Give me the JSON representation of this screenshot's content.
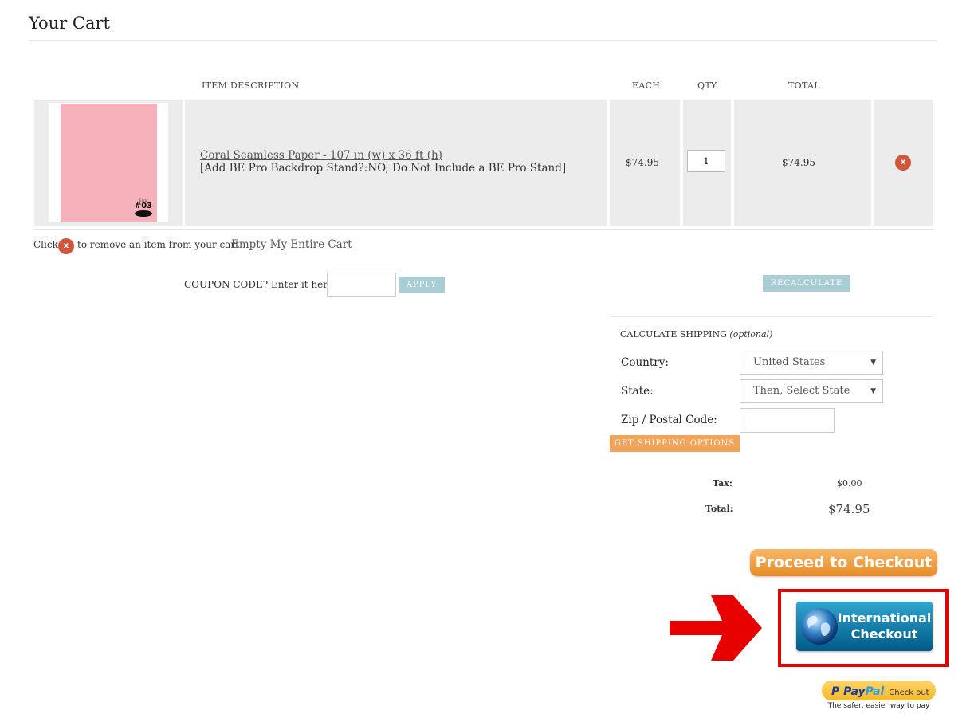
{
  "page": {
    "title": "Your Cart"
  },
  "columns": {
    "description": "ITEM  DESCRIPTION",
    "each": "EACH",
    "qty": "QTY",
    "total": "TOTAL"
  },
  "item": {
    "thumb_label": "Coral",
    "thumb_number": "#03",
    "name": "Coral Seamless Paper - 107 in (w) x 36 ft (h)",
    "option": "[Add BE Pro Backdrop Stand?:NO, Do Not Include a BE Pro Stand]",
    "each": "$74.95",
    "qty": "1",
    "total": "$74.95",
    "swatch_color": "#f6b1ba"
  },
  "remove_note": {
    "before": "Click",
    "after": "to remove an item from your cart",
    "empty_cart": "Empty My Entire Cart",
    "icon_glyph": "x"
  },
  "coupon": {
    "label": "COUPON CODE? Enter it here:",
    "value": "",
    "apply": "APPLY"
  },
  "recalculate": "RECALCULATE",
  "shipping": {
    "title": "CALCULATE SHIPPING",
    "title_note": "(optional)",
    "country_label": "Country:",
    "country_value": "United States",
    "state_label": "State:",
    "state_value": "Then, Select State",
    "zip_label": "Zip / Postal Code:",
    "zip_value": "",
    "get_options": "GET SHIPPING OPTIONS"
  },
  "summary": {
    "tax_label": "Tax:",
    "tax_value": "$0.00",
    "total_label": "Total:",
    "total_value": "$74.95"
  },
  "checkout": {
    "label": "Proceed to Checkout ►"
  },
  "international": {
    "line1": "International",
    "line2": "Checkout"
  },
  "paypal": {
    "logo_pay": "Pay",
    "logo_pal": "Pal",
    "label": "Check out",
    "tagline": "The safer, easier way to pay"
  },
  "colors": {
    "remove_red": "#d2563d",
    "teal_button": "#a9cdd4",
    "orange_button": "#f2a55a",
    "highlight_red": "#e60000"
  }
}
